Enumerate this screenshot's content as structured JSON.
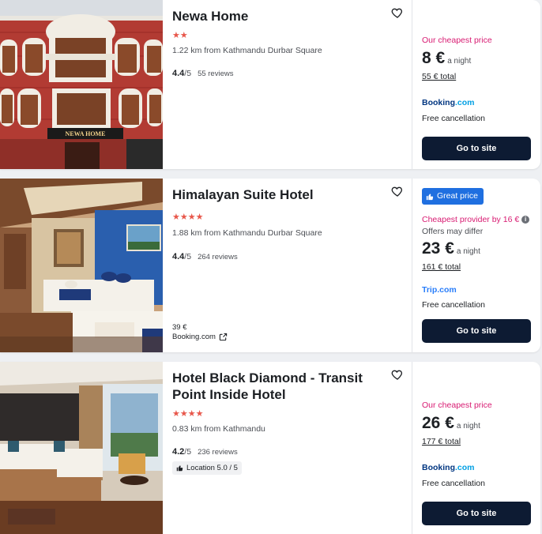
{
  "hotels": [
    {
      "name": "Newa Home",
      "stars": "★★",
      "distance": "1.22 km from Kathmandu Durbar Square",
      "rating": "4.4",
      "rating_suffix": "/5",
      "reviews": "55 reviews",
      "price_label": "Our cheapest price",
      "price": "8 €",
      "per_night": "a night",
      "total": "55 € total",
      "provider_main": "Booking",
      "provider_tld": ".com",
      "cancellation": "Free cancellation",
      "button": "Go to site",
      "signage": "NEWA HOME"
    },
    {
      "name": "Himalayan Suite Hotel",
      "stars": "★★★★",
      "distance": "1.88 km from Kathmandu Durbar Square",
      "rating": "4.4",
      "rating_suffix": "/5",
      "reviews": "264 reviews",
      "badge": "Great price",
      "price_label": "Cheapest provider by 16 €",
      "offers_note": "Offers may differ",
      "price": "23 €",
      "per_night": "a night",
      "total": "161 € total",
      "provider_main": "Trip",
      "provider_tld": ".com",
      "cancellation": "Free cancellation",
      "button": "Go to site",
      "alt_price": "39 €",
      "alt_provider": "Booking.com"
    },
    {
      "name": "Hotel Black Diamond - Transit Point Inside Hotel",
      "stars": "★★★★",
      "distance": "0.83 km from Kathmandu",
      "rating": "4.2",
      "rating_suffix": "/5",
      "reviews": "236 reviews",
      "location_badge": "Location 5.0 / 5",
      "price_label": "Our cheapest price",
      "price": "26 €",
      "per_night": "a night",
      "total": "177 € total",
      "provider_main": "Booking",
      "provider_tld": ".com",
      "cancellation": "Free cancellation",
      "button": "Go to site"
    }
  ],
  "colors": {
    "accent_pink": "#d81b72",
    "button_bg": "#0d1b33",
    "badge_blue": "#1f6fe0",
    "stars": "#e8574b",
    "booking_blue": "#003580",
    "booking_light": "#009fe3",
    "trip_blue": "#287dfa"
  }
}
